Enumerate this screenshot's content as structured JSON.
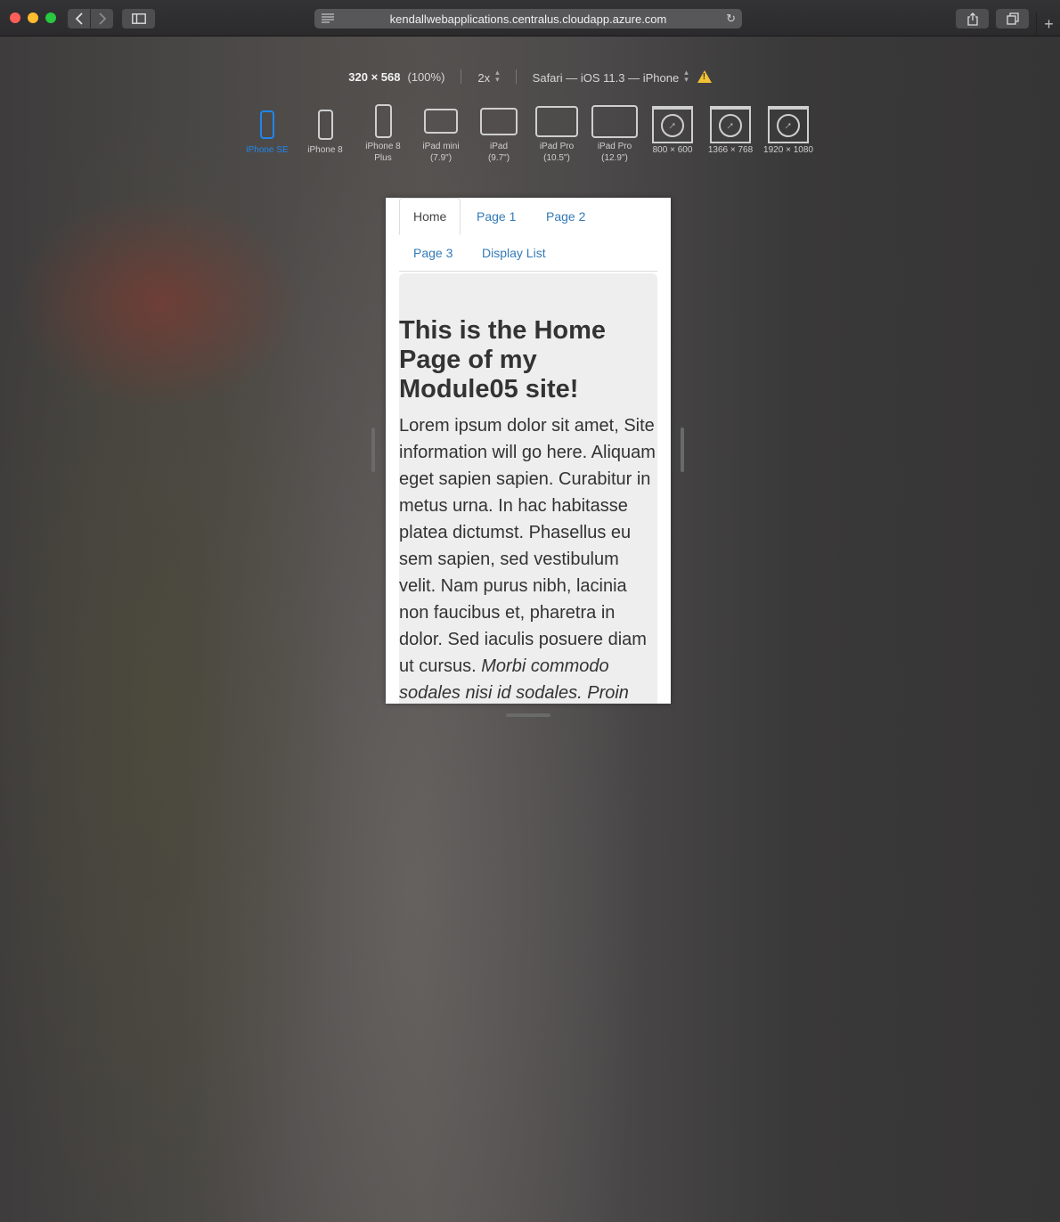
{
  "browser": {
    "url": "kendallwebapplications.centralus.cloudapp.azure.com",
    "new_tab_glyph": "+"
  },
  "responsive_toolbar": {
    "dimensions": "320 × 568",
    "zoom": "(100%)",
    "pixel_ratio": "2x",
    "user_agent": "Safari — iOS 11.3 — iPhone",
    "devices": [
      {
        "label_line1": "iPhone SE",
        "label_line2": "",
        "selected": true
      },
      {
        "label_line1": "iPhone 8",
        "label_line2": ""
      },
      {
        "label_line1": "iPhone 8",
        "label_line2": "Plus"
      },
      {
        "label_line1": "iPad mini",
        "label_line2": "(7.9\")"
      },
      {
        "label_line1": "iPad",
        "label_line2": "(9.7\")"
      },
      {
        "label_line1": "iPad Pro",
        "label_line2": "(10.5\")"
      },
      {
        "label_line1": "iPad Pro",
        "label_line2": "(12.9\")"
      },
      {
        "label_line1": "800 × 600",
        "label_line2": ""
      },
      {
        "label_line1": "1366 × 768",
        "label_line2": ""
      },
      {
        "label_line1": "1920 × 1080",
        "label_line2": ""
      }
    ]
  },
  "site": {
    "nav": [
      "Home",
      "Page 1",
      "Page 2",
      "Page 3",
      "Display List"
    ],
    "heading": "This is the Home Page of my Module05 site!",
    "body_start": "Lorem ipsum dolor sit amet, ",
    "body_bold": "Site information will go here",
    "body_middle": ". Aliquam eget sapien sapien. Curabitur in metus urna. In hac habitasse platea dictumst. Phasellus eu sem sapien, sed vestibulum velit. Nam purus nibh, lacinia non faucibus et, pharetra in dolor. Sed iaculis posuere diam ut cursus. ",
    "body_italic": "Morbi commodo sodales nisi id sodales. Proin"
  },
  "colors": {
    "link": "#337ab7",
    "selected_device": "#1e86f0"
  }
}
